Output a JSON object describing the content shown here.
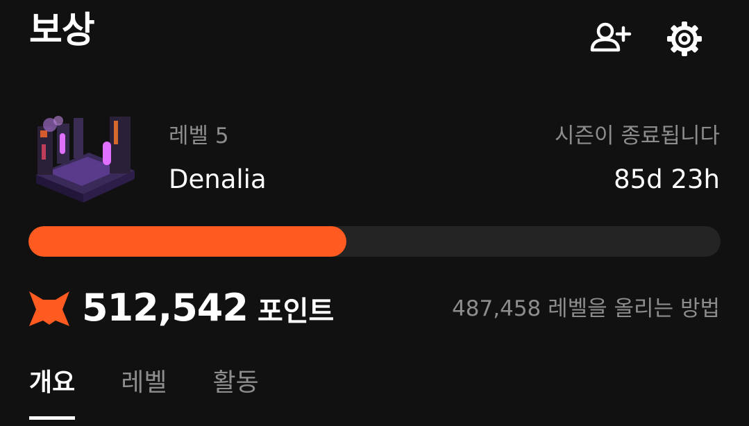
{
  "header": {
    "title": "보상",
    "add_friend_icon": "person-add-icon",
    "settings_icon": "gear-icon"
  },
  "season": {
    "level_label": "레벨 5",
    "name": "Denalia",
    "ends_label": "시즌이 종료됩니다",
    "remaining": "85d 23h"
  },
  "progress": {
    "percent": 45.9
  },
  "points": {
    "icon": "fox-head-icon",
    "value": "512,542",
    "unit": "포인트",
    "level_up_link": "487,458 레벨을 올리는 방법"
  },
  "tabs": [
    {
      "label": "개요",
      "active": true
    },
    {
      "label": "레벨",
      "active": false
    },
    {
      "label": "활동",
      "active": false
    }
  ],
  "colors": {
    "background": "#111111",
    "accent": "#ff5a1f",
    "track": "#242424",
    "muted_text": "#8d8d8d",
    "text": "#ffffff"
  }
}
